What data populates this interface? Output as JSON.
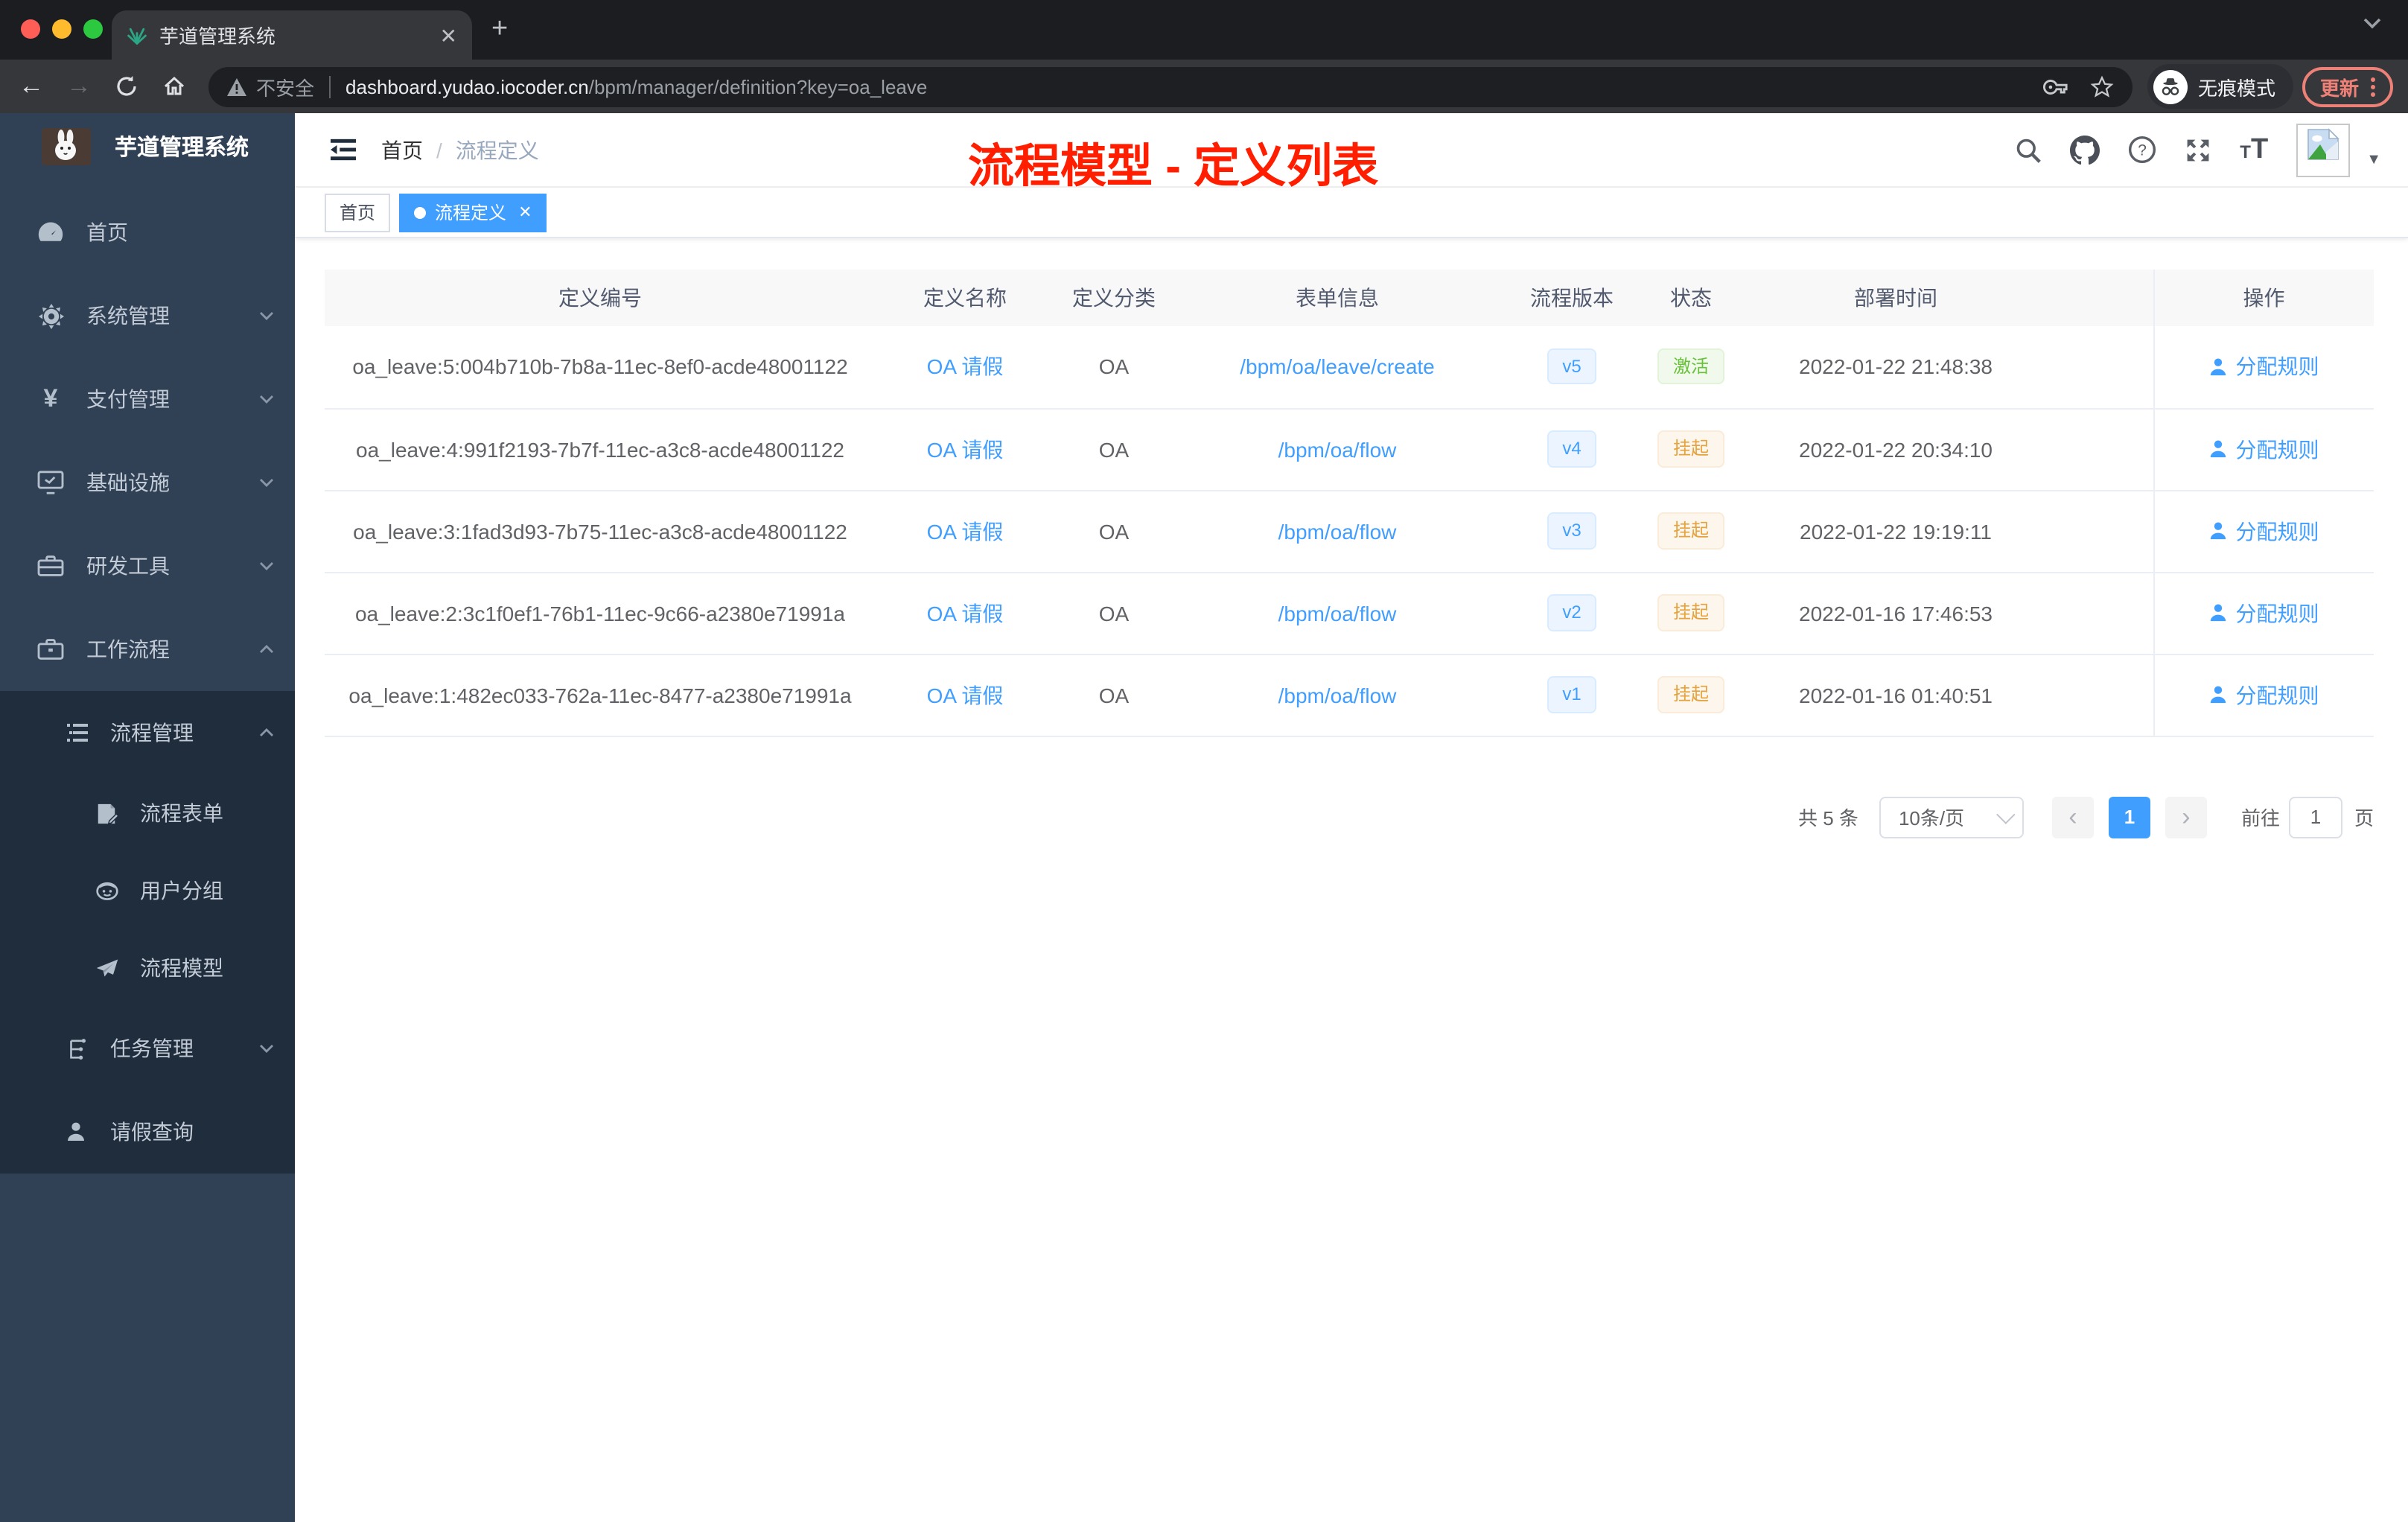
{
  "colors": {
    "accent": "#409eff",
    "success": "#67c23a",
    "warning": "#e6a23c",
    "annotation_red": "#ff1e00",
    "sidebar_bg": "#304156",
    "sidebar_submenu_bg": "#1f2d3d"
  },
  "browser": {
    "tab_title": "芋道管理系统",
    "security_label": "不安全",
    "url_host": "dashboard.yudao.iocoder.cn",
    "url_path": "/bpm/manager/definition?key=oa_leave",
    "incognito_label": "无痕模式",
    "update_label": "更新"
  },
  "annotation": {
    "title": "流程模型 - 定义列表"
  },
  "sidebar": {
    "app_title": "芋道管理系统",
    "items": [
      {
        "label": "首页",
        "icon": "dashboard-icon"
      },
      {
        "label": "系统管理",
        "icon": "gear-icon"
      },
      {
        "label": "支付管理",
        "icon": "yen-icon"
      },
      {
        "label": "基础设施",
        "icon": "monitor-icon"
      },
      {
        "label": "研发工具",
        "icon": "toolbox-icon"
      },
      {
        "label": "工作流程",
        "icon": "briefcase-icon"
      }
    ],
    "workflow_children": [
      {
        "label": "流程管理",
        "icon": "list-tree-icon"
      },
      {
        "label": "流程表单",
        "icon": "form-doc-icon"
      },
      {
        "label": "用户分组",
        "icon": "robot-icon"
      },
      {
        "label": "流程模型",
        "icon": "paper-plane-icon"
      },
      {
        "label": "任务管理",
        "icon": "org-tree-icon"
      },
      {
        "label": "请假查询",
        "icon": "person-icon"
      }
    ]
  },
  "header": {
    "breadcrumb_home": "首页",
    "breadcrumb_current": "流程定义"
  },
  "tags": {
    "home": "首页",
    "active": "流程定义"
  },
  "table": {
    "columns": [
      "定义编号",
      "定义名称",
      "定义分类",
      "表单信息",
      "流程版本",
      "状态",
      "部署时间",
      "操作"
    ],
    "rows": [
      {
        "id": "oa_leave:5:004b710b-7b8a-11ec-8ef0-acde48001122",
        "name": "OA 请假",
        "category": "OA",
        "form": "/bpm/oa/leave/create",
        "version": "v5",
        "status": "激活",
        "status_type": "success",
        "time": "2022-01-22 21:48:38",
        "action": "分配规则"
      },
      {
        "id": "oa_leave:4:991f2193-7b7f-11ec-a3c8-acde48001122",
        "name": "OA 请假",
        "category": "OA",
        "form": "/bpm/oa/flow",
        "version": "v4",
        "status": "挂起",
        "status_type": "warning",
        "time": "2022-01-22 20:34:10",
        "action": "分配规则"
      },
      {
        "id": "oa_leave:3:1fad3d93-7b75-11ec-a3c8-acde48001122",
        "name": "OA 请假",
        "category": "OA",
        "form": "/bpm/oa/flow",
        "version": "v3",
        "status": "挂起",
        "status_type": "warning",
        "time": "2022-01-22 19:19:11",
        "action": "分配规则"
      },
      {
        "id": "oa_leave:2:3c1f0ef1-76b1-11ec-9c66-a2380e71991a",
        "name": "OA 请假",
        "category": "OA",
        "form": "/bpm/oa/flow",
        "version": "v2",
        "status": "挂起",
        "status_type": "warning",
        "time": "2022-01-16 17:46:53",
        "action": "分配规则"
      },
      {
        "id": "oa_leave:1:482ec033-762a-11ec-8477-a2380e71991a",
        "name": "OA 请假",
        "category": "OA",
        "form": "/bpm/oa/flow",
        "version": "v1",
        "status": "挂起",
        "status_type": "warning",
        "time": "2022-01-16 01:40:51",
        "action": "分配规则"
      }
    ]
  },
  "pagination": {
    "total": "共 5 条",
    "page_size": "10条/页",
    "current_page": "1",
    "goto_label": "前往",
    "goto_value": "1",
    "page_unit": "页"
  }
}
